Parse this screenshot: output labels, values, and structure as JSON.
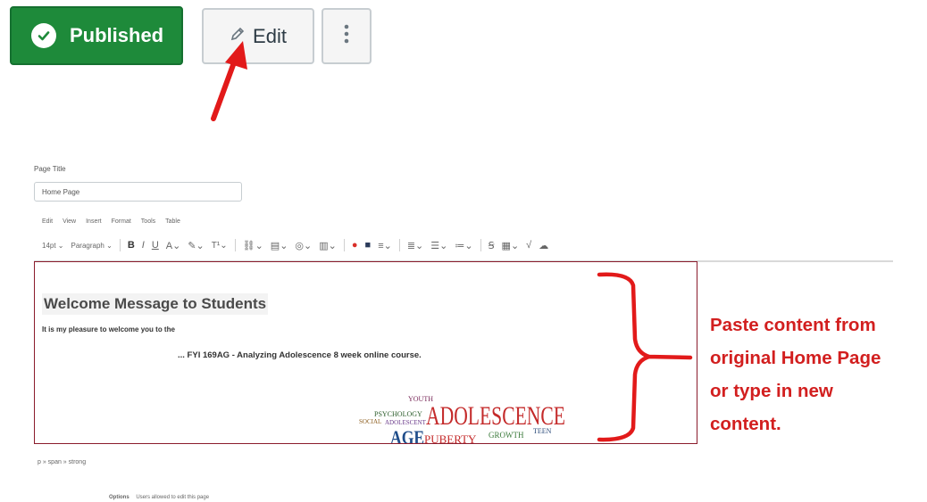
{
  "header": {
    "published_label": "Published",
    "edit_label": "Edit",
    "accent_green": "#1e8a3a"
  },
  "editor": {
    "page_title_label": "Page Title",
    "page_title_value": "Home Page",
    "menu": [
      "Edit",
      "View",
      "Insert",
      "Format",
      "Tools",
      "Table"
    ],
    "toolbar": {
      "font_size": "14pt",
      "block_format": "Paragraph"
    },
    "content": {
      "heading": "Welcome Message to Students",
      "line1": "It is my pleasure to welcome you to the",
      "line2": "... FYI 169AG - Analyzing Adolescence 8 week online course.",
      "wordcloud": [
        "ADOLESCENCE",
        "AGE",
        "PUBERTY",
        "PSYCHOLOGY",
        "ADOLESCENT",
        "SOCIAL",
        "GROWTH",
        "YOUTH",
        "TEEN"
      ]
    },
    "path": "p » span » strong",
    "options_label": "Options",
    "options_value": "Users allowed to edit this page"
  },
  "annotation": {
    "lines": [
      "Paste content from",
      "original Home Page",
      "or type in new",
      "content."
    ],
    "color": "#d21f1f"
  }
}
